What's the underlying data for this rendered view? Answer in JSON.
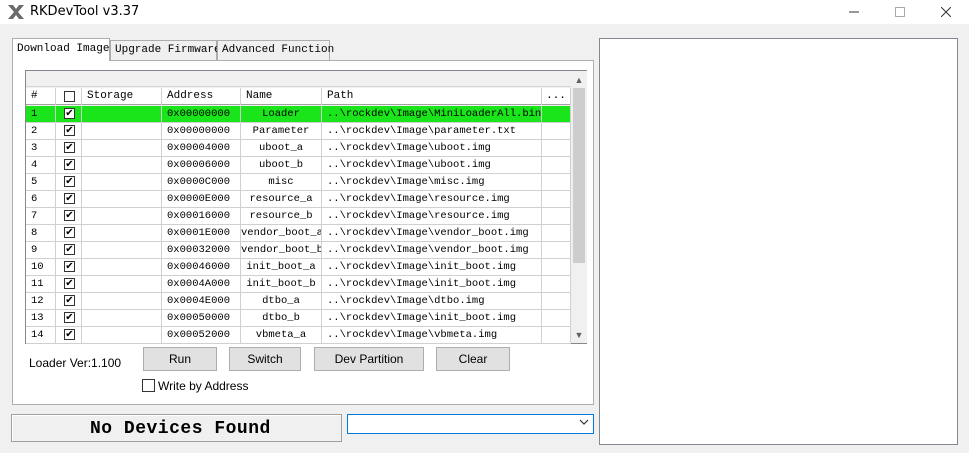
{
  "window": {
    "title": "RKDevTool v3.37"
  },
  "tabs": [
    {
      "label": "Download Image",
      "active": true
    },
    {
      "label": "Upgrade Firmware",
      "active": false
    },
    {
      "label": "Advanced Function",
      "active": false
    }
  ],
  "table": {
    "headers": {
      "num": "#",
      "storage": "Storage",
      "address": "Address",
      "name": "Name",
      "path": "Path",
      "more": "..."
    },
    "rows": [
      {
        "num": "1",
        "checked": true,
        "storage": "",
        "address": "0x00000000",
        "name": "Loader",
        "path": "..\\rockdev\\Image\\MiniLoaderAll.bin"
      },
      {
        "num": "2",
        "checked": true,
        "storage": "",
        "address": "0x00000000",
        "name": "Parameter",
        "path": "..\\rockdev\\Image\\parameter.txt"
      },
      {
        "num": "3",
        "checked": true,
        "storage": "",
        "address": "0x00004000",
        "name": "uboot_a",
        "path": "..\\rockdev\\Image\\uboot.img"
      },
      {
        "num": "4",
        "checked": true,
        "storage": "",
        "address": "0x00006000",
        "name": "uboot_b",
        "path": "..\\rockdev\\Image\\uboot.img"
      },
      {
        "num": "5",
        "checked": true,
        "storage": "",
        "address": "0x0000C000",
        "name": "misc",
        "path": "..\\rockdev\\Image\\misc.img"
      },
      {
        "num": "6",
        "checked": true,
        "storage": "",
        "address": "0x0000E000",
        "name": "resource_a",
        "path": "..\\rockdev\\Image\\resource.img"
      },
      {
        "num": "7",
        "checked": true,
        "storage": "",
        "address": "0x00016000",
        "name": "resource_b",
        "path": "..\\rockdev\\Image\\resource.img"
      },
      {
        "num": "8",
        "checked": true,
        "storage": "",
        "address": "0x0001E000",
        "name": "vendor_boot_a",
        "path": "..\\rockdev\\Image\\vendor_boot.img"
      },
      {
        "num": "9",
        "checked": true,
        "storage": "",
        "address": "0x00032000",
        "name": "vendor_boot_b",
        "path": "..\\rockdev\\Image\\vendor_boot.img"
      },
      {
        "num": "10",
        "checked": true,
        "storage": "",
        "address": "0x00046000",
        "name": "init_boot_a",
        "path": "..\\rockdev\\Image\\init_boot.img"
      },
      {
        "num": "11",
        "checked": true,
        "storage": "",
        "address": "0x0004A000",
        "name": "init_boot_b",
        "path": "..\\rockdev\\Image\\init_boot.img"
      },
      {
        "num": "12",
        "checked": true,
        "storage": "",
        "address": "0x0004E000",
        "name": "dtbo_a",
        "path": "..\\rockdev\\Image\\dtbo.img"
      },
      {
        "num": "13",
        "checked": true,
        "storage": "",
        "address": "0x00050000",
        "name": "dtbo_b",
        "path": "..\\rockdev\\Image\\init_boot.img"
      },
      {
        "num": "14",
        "checked": true,
        "storage": "",
        "address": "0x00052000",
        "name": "vbmeta_a",
        "path": "..\\rockdev\\Image\\vbmeta.img"
      }
    ],
    "selected_row": 0,
    "highlight_color": "#1ae41a"
  },
  "controls": {
    "loader_version": "Loader Ver:1.100",
    "run_label": "Run",
    "switch_label": "Switch",
    "dev_partition_label": "Dev Partition",
    "clear_label": "Clear",
    "write_by_address_label": "Write by Address",
    "write_by_address_checked": false
  },
  "status": {
    "text": "No Devices Found",
    "combo_value": ""
  },
  "icons": {
    "minimize": "minimize-icon",
    "maximize": "maximize-icon",
    "close": "close-icon",
    "app": "rockchip-icon"
  }
}
